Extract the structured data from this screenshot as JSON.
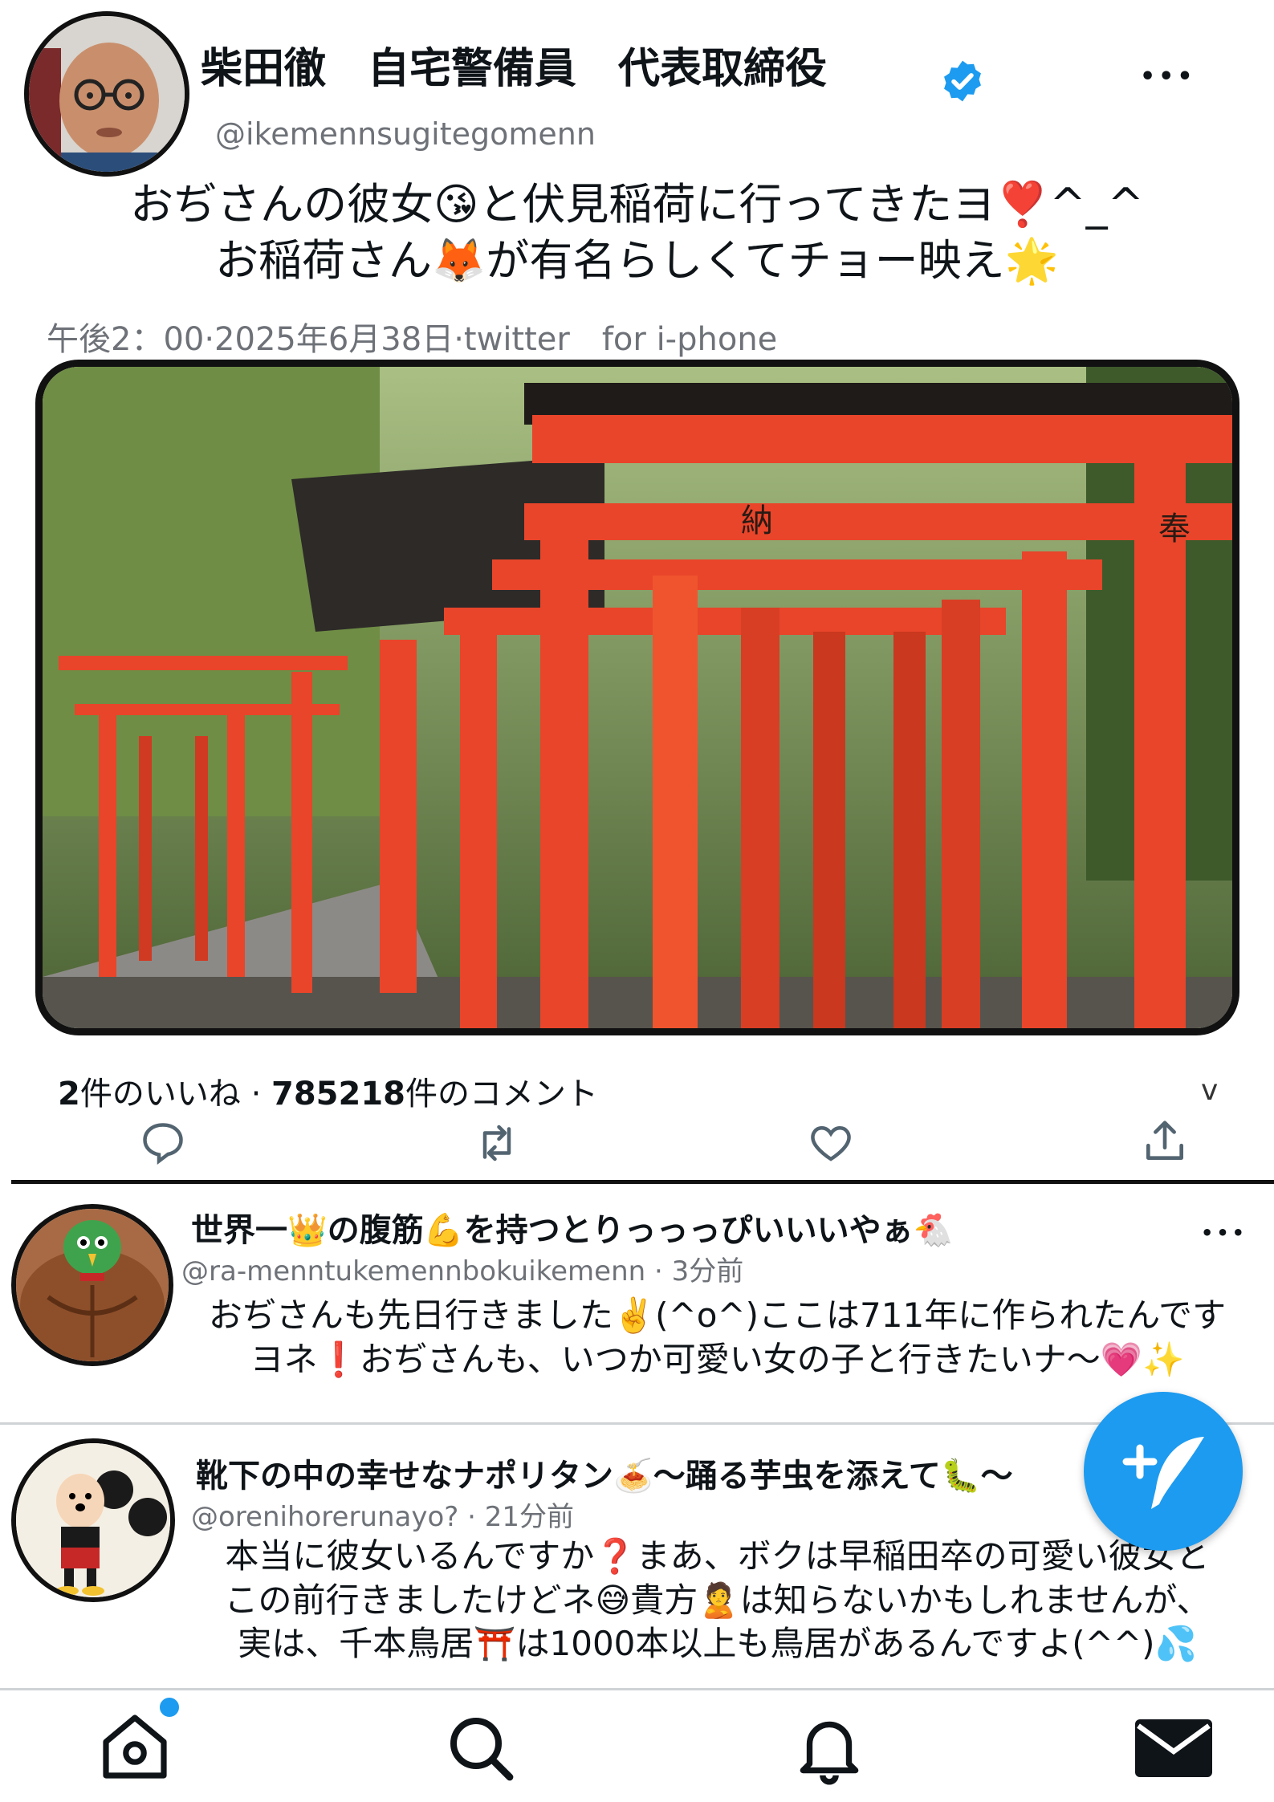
{
  "post": {
    "author_name": "柴田徹　自宅警備員　代表取締役",
    "handle": "@ikemennsugitegomenn",
    "more": "•••",
    "text_line1": "おぢさんの彼女😘と伏見稲荷に行ってきたヨ❣️^_^",
    "text_line2": "お稲荷さん🦊が有名らしくてチョー映え🌟",
    "meta": "午後2：00·2025年6月38日·twitter　for i-phone",
    "photo_text_1": "納",
    "photo_text_2": "奉",
    "likes_count": "2",
    "likes_label": "件のいいね",
    "sep": "·",
    "comments_count": "785218",
    "comments_label": "件のコメント",
    "expand": "v",
    "icons": [
      "reply-icon",
      "retweet-icon",
      "heart-icon",
      "share-icon"
    ],
    "verified_color": "#1d9bf0",
    "torii_color": "#e8452a"
  },
  "replies": [
    {
      "name": "世界一👑の腹筋💪を持つとりっっっぴいいいやぁ🐔",
      "handle": "@ra-menntukemennbokuikemenn · 3分前",
      "line1": "おぢさんも先日行きました✌️(^o^)ここは711年に作られたんです",
      "line2": "ヨネ❗おぢさんも、いつか可愛い女の子と行きたいナ〜💗✨",
      "more": "•••"
    },
    {
      "name": "靴下の中の幸せなナポリタン🍝〜踊る芋虫を添えて🐛〜",
      "handle": "@orenihorerunayo? · 21分前",
      "line1": "本当に彼女いるんですか❓まあ、ボクは早稲田卒の可愛い彼女と",
      "line2": "この前行きましたけどネ😅貴方🙎は知らないかもしれませんが、",
      "line3": "実は、千本鳥居⛩️は1000本以上も鳥居があるんですよ(^^)💦"
    }
  ],
  "compose_button": {
    "icon": "feather-plus-icon",
    "color": "#1d9bf0"
  },
  "bottom_nav": [
    "home-icon",
    "search-icon",
    "bell-icon",
    "mail-icon"
  ],
  "notification_dot_color": "#1d9bf0"
}
